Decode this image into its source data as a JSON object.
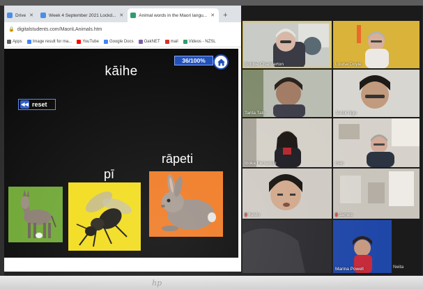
{
  "browser": {
    "tabs": [
      {
        "label": "Drive",
        "active": false
      },
      {
        "label": "Week 4 September 2021 Lockd...",
        "active": false
      },
      {
        "label": "Animal words in the Maori langu...",
        "active": true
      }
    ],
    "new_tab": "+",
    "url": "digitalstudents.com/MaoriLAnimals.htm",
    "bookmarks": [
      {
        "label": "Apps",
        "color": "#5f6368"
      },
      {
        "label": "Image result for ma...",
        "color": "#4285f4"
      },
      {
        "label": "YouTube",
        "color": "#ff0000"
      },
      {
        "label": "Google Docs",
        "color": "#4285f4"
      },
      {
        "label": "OakNET",
        "color": "#7b5ea7"
      },
      {
        "label": "mail",
        "color": "#d93025"
      },
      {
        "label": "Videos - NZSL",
        "color": "#2f9e6e"
      }
    ]
  },
  "game": {
    "title": "kāihe",
    "score": "36/100",
    "score_suffix": "%",
    "reset_label": "reset",
    "words": [
      "pī",
      "rāpeti"
    ],
    "cards": [
      {
        "name": "donkey-card",
        "bg": "#6fa735"
      },
      {
        "name": "bee-card",
        "bg": "#f2dc1c"
      },
      {
        "name": "rabbit-card",
        "bg": "#f07a23"
      }
    ]
  },
  "participants": [
    {
      "name": "Bobbie Chadderton",
      "speaking": true
    },
    {
      "name": "Louise Doyle",
      "speaking": false
    },
    {
      "name": "Tarita Tatu",
      "speaking": false
    },
    {
      "name": "Jerick Ngo",
      "speaking": false
    },
    {
      "name": "Inoka Fernando",
      "speaking": false
    },
    {
      "name": "mac",
      "speaking": false
    },
    {
      "name": "Kevin",
      "speaking": false,
      "muted": true
    },
    {
      "name": "James",
      "speaking": false,
      "muted": true
    },
    {
      "name": "Marina Powell",
      "speaking": false
    },
    {
      "name": "Neita",
      "speaking": false
    }
  ],
  "colors": {
    "accent": "#1f4fb8",
    "speaker_outline": "#e3c84a"
  }
}
